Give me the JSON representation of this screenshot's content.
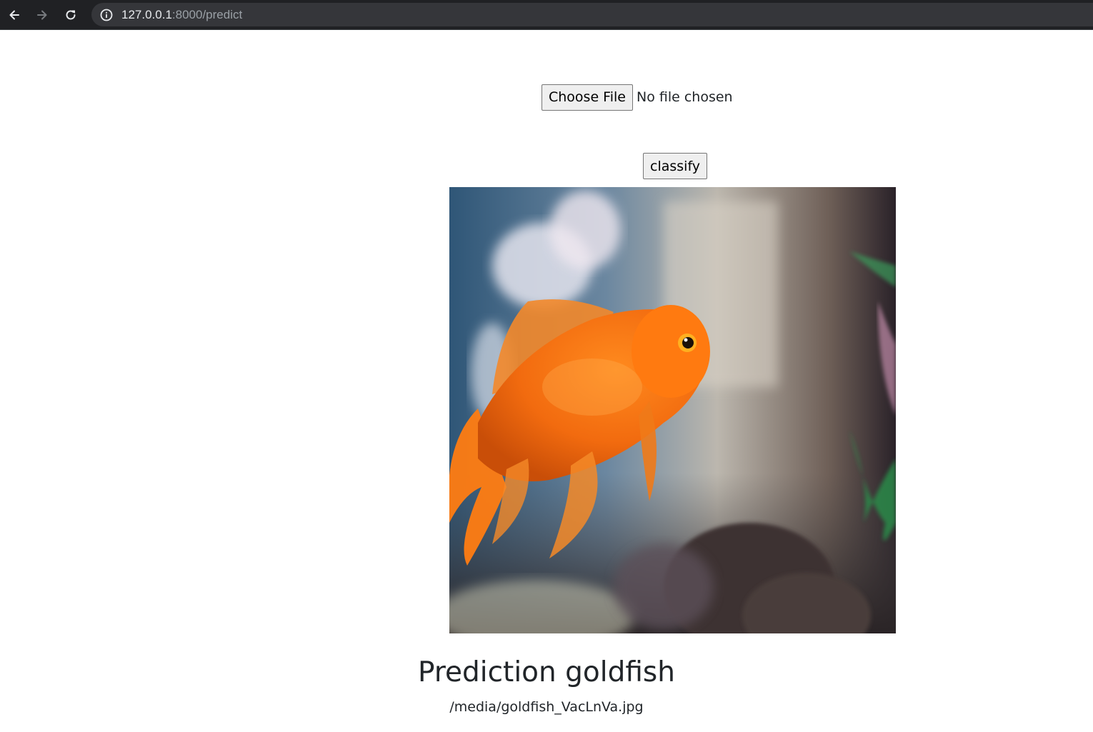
{
  "browser": {
    "url_host": "127.0.0.1",
    "url_path": ":8000/predict"
  },
  "page": {
    "file_input": {
      "button_label": "Choose File",
      "status": "No file chosen"
    },
    "classify_label": "classify",
    "prediction_text": "Prediction goldfish",
    "media_path": "/media/goldfish_VacLnVa.jpg"
  },
  "colors": {
    "chrome_bg": "#202124",
    "omnibox_bg": "#35363a",
    "text": "#212529",
    "fish": "#f26b0f"
  }
}
